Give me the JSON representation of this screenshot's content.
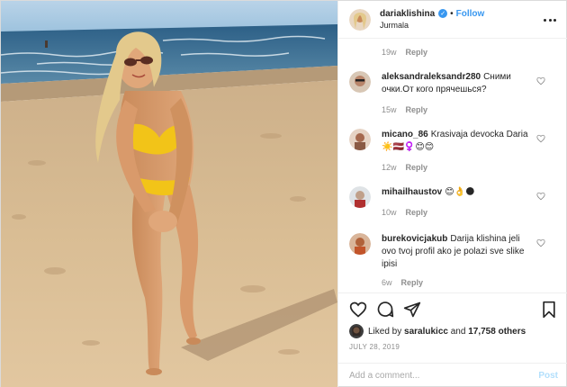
{
  "header": {
    "username": "dariaklishina",
    "verified_mark": "✓",
    "separator": "•",
    "follow_label": "Follow",
    "location": "Jurmala",
    "more_icon": "more-horizontal-icon"
  },
  "comments": {
    "top_meta": {
      "age": "19w",
      "reply": "Reply"
    },
    "items": [
      {
        "username": "aleksandraleksandr280",
        "text": "Сними очки.От кого прячешься?",
        "age": "15w",
        "reply": "Reply"
      },
      {
        "username": "micano_86",
        "text": "Krasivaja devocka Daria ☀️🇱🇻♀️😊😊",
        "age": "12w",
        "reply": "Reply"
      },
      {
        "username": "mihailhaustov",
        "text": "😊👌🌑",
        "age": "10w",
        "reply": "Reply"
      },
      {
        "username": "burekovicjakub",
        "text": "Darija klishina jeli ovo tvoj profil ako je polazi sve slike ipisi",
        "age": "6w",
        "reply": "Reply"
      }
    ]
  },
  "actions": {
    "like_icon": "heart-icon",
    "comment_icon": "comment-icon",
    "share_icon": "paper-plane-icon",
    "save_icon": "bookmark-icon"
  },
  "likes": {
    "prefix": "Liked by",
    "user": "saralukicc",
    "joiner": "and",
    "others": "17,758 others"
  },
  "date": "JULY 28, 2019",
  "add_comment": {
    "placeholder": "Add a comment...",
    "post_label": "Post"
  },
  "colors": {
    "link_blue": "#3897f0",
    "post_disabled": "#b2dffc",
    "muted_text": "#8e8e8e",
    "border": "#efefef",
    "sand": "#d9b98e",
    "sea": "#3a6f93",
    "sky": "#8fb9d9",
    "bikini": "#f2c418"
  }
}
